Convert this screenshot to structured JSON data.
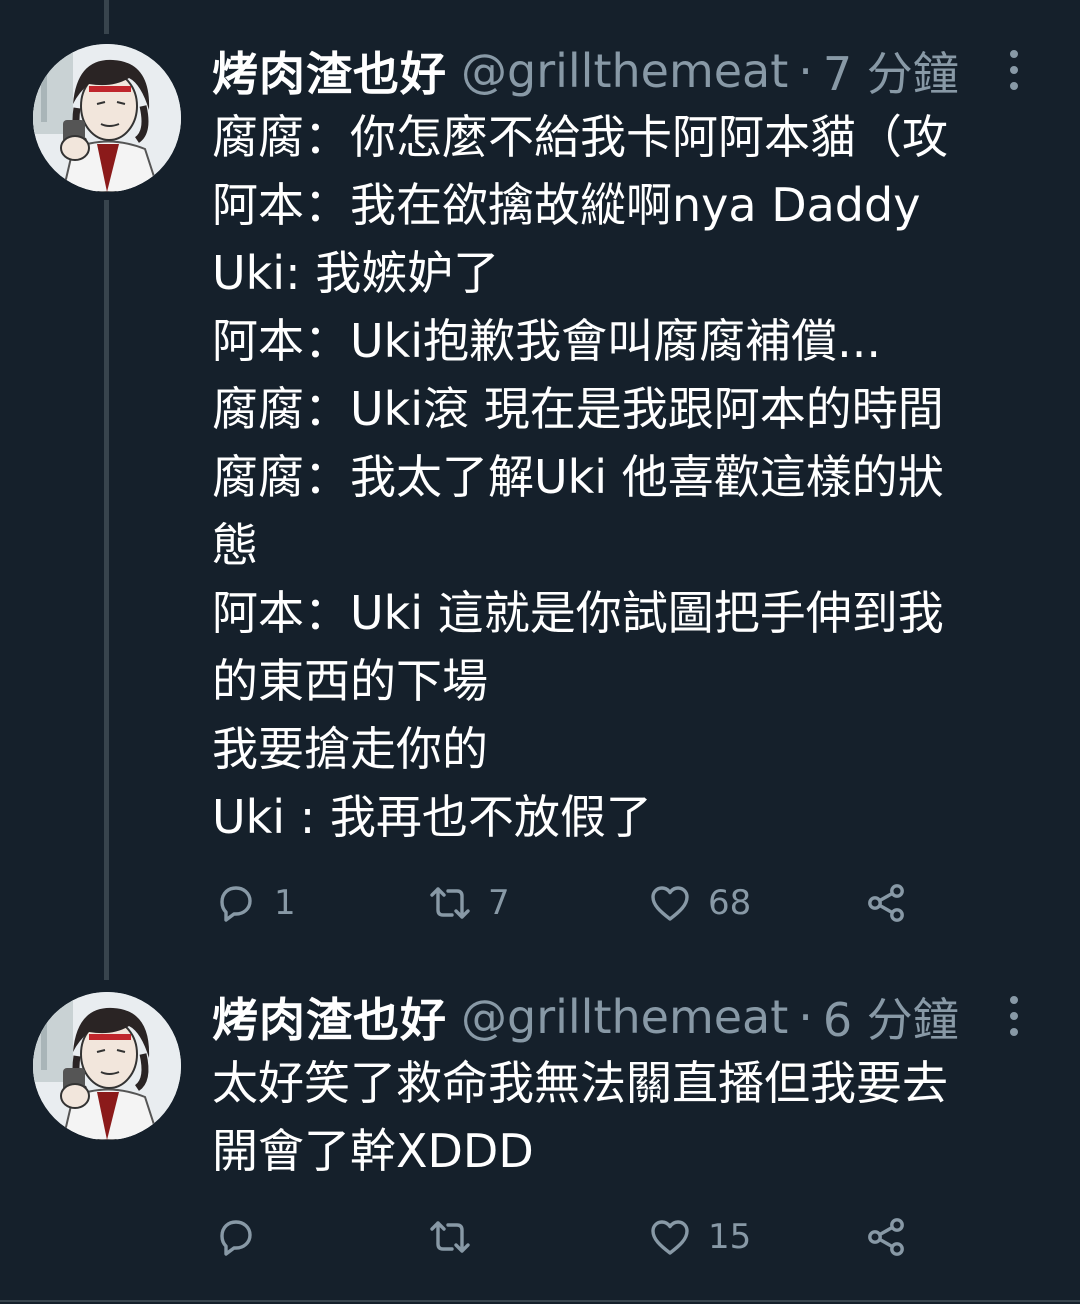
{
  "tweets": [
    {
      "display_name": "烤肉渣也好",
      "handle": "@grillthemeat",
      "separator": "·",
      "time": "7 分鐘",
      "lines": [
        "腐腐：你怎麼不給我卡阿阿本貓（攻",
        "阿本：我在欲擒故縱啊nya Daddy",
        "Uki: 我嫉妒了",
        "阿本：Uki抱歉我會叫腐腐補償...",
        "腐腐：Uki滾 現在是我跟阿本的時間",
        "腐腐：我太了解Uki 他喜歡這樣的狀",
        "態",
        "阿本：Uki 這就是你試圖把手伸到我",
        "的東西的下場",
        "我要搶走你的",
        "Uki : 我再也不放假了"
      ],
      "reply_count": "1",
      "retweet_count": "7",
      "like_count": "68"
    },
    {
      "display_name": "烤肉渣也好",
      "handle": "@grillthemeat",
      "separator": "·",
      "time": "6 分鐘",
      "lines": [
        "太好笑了救命我無法關直播但我要去",
        "開會了幹XDDD"
      ],
      "reply_count": "",
      "retweet_count": "",
      "like_count": "15"
    }
  ],
  "icons": {
    "reply": "reply-icon",
    "retweet": "retweet-icon",
    "like": "heart-icon",
    "share": "share-icon",
    "more": "more-vertical-icon"
  },
  "colors": {
    "background": "#15202b",
    "text": "#ffffff",
    "secondary": "#8899a6",
    "divider": "#38444d"
  }
}
